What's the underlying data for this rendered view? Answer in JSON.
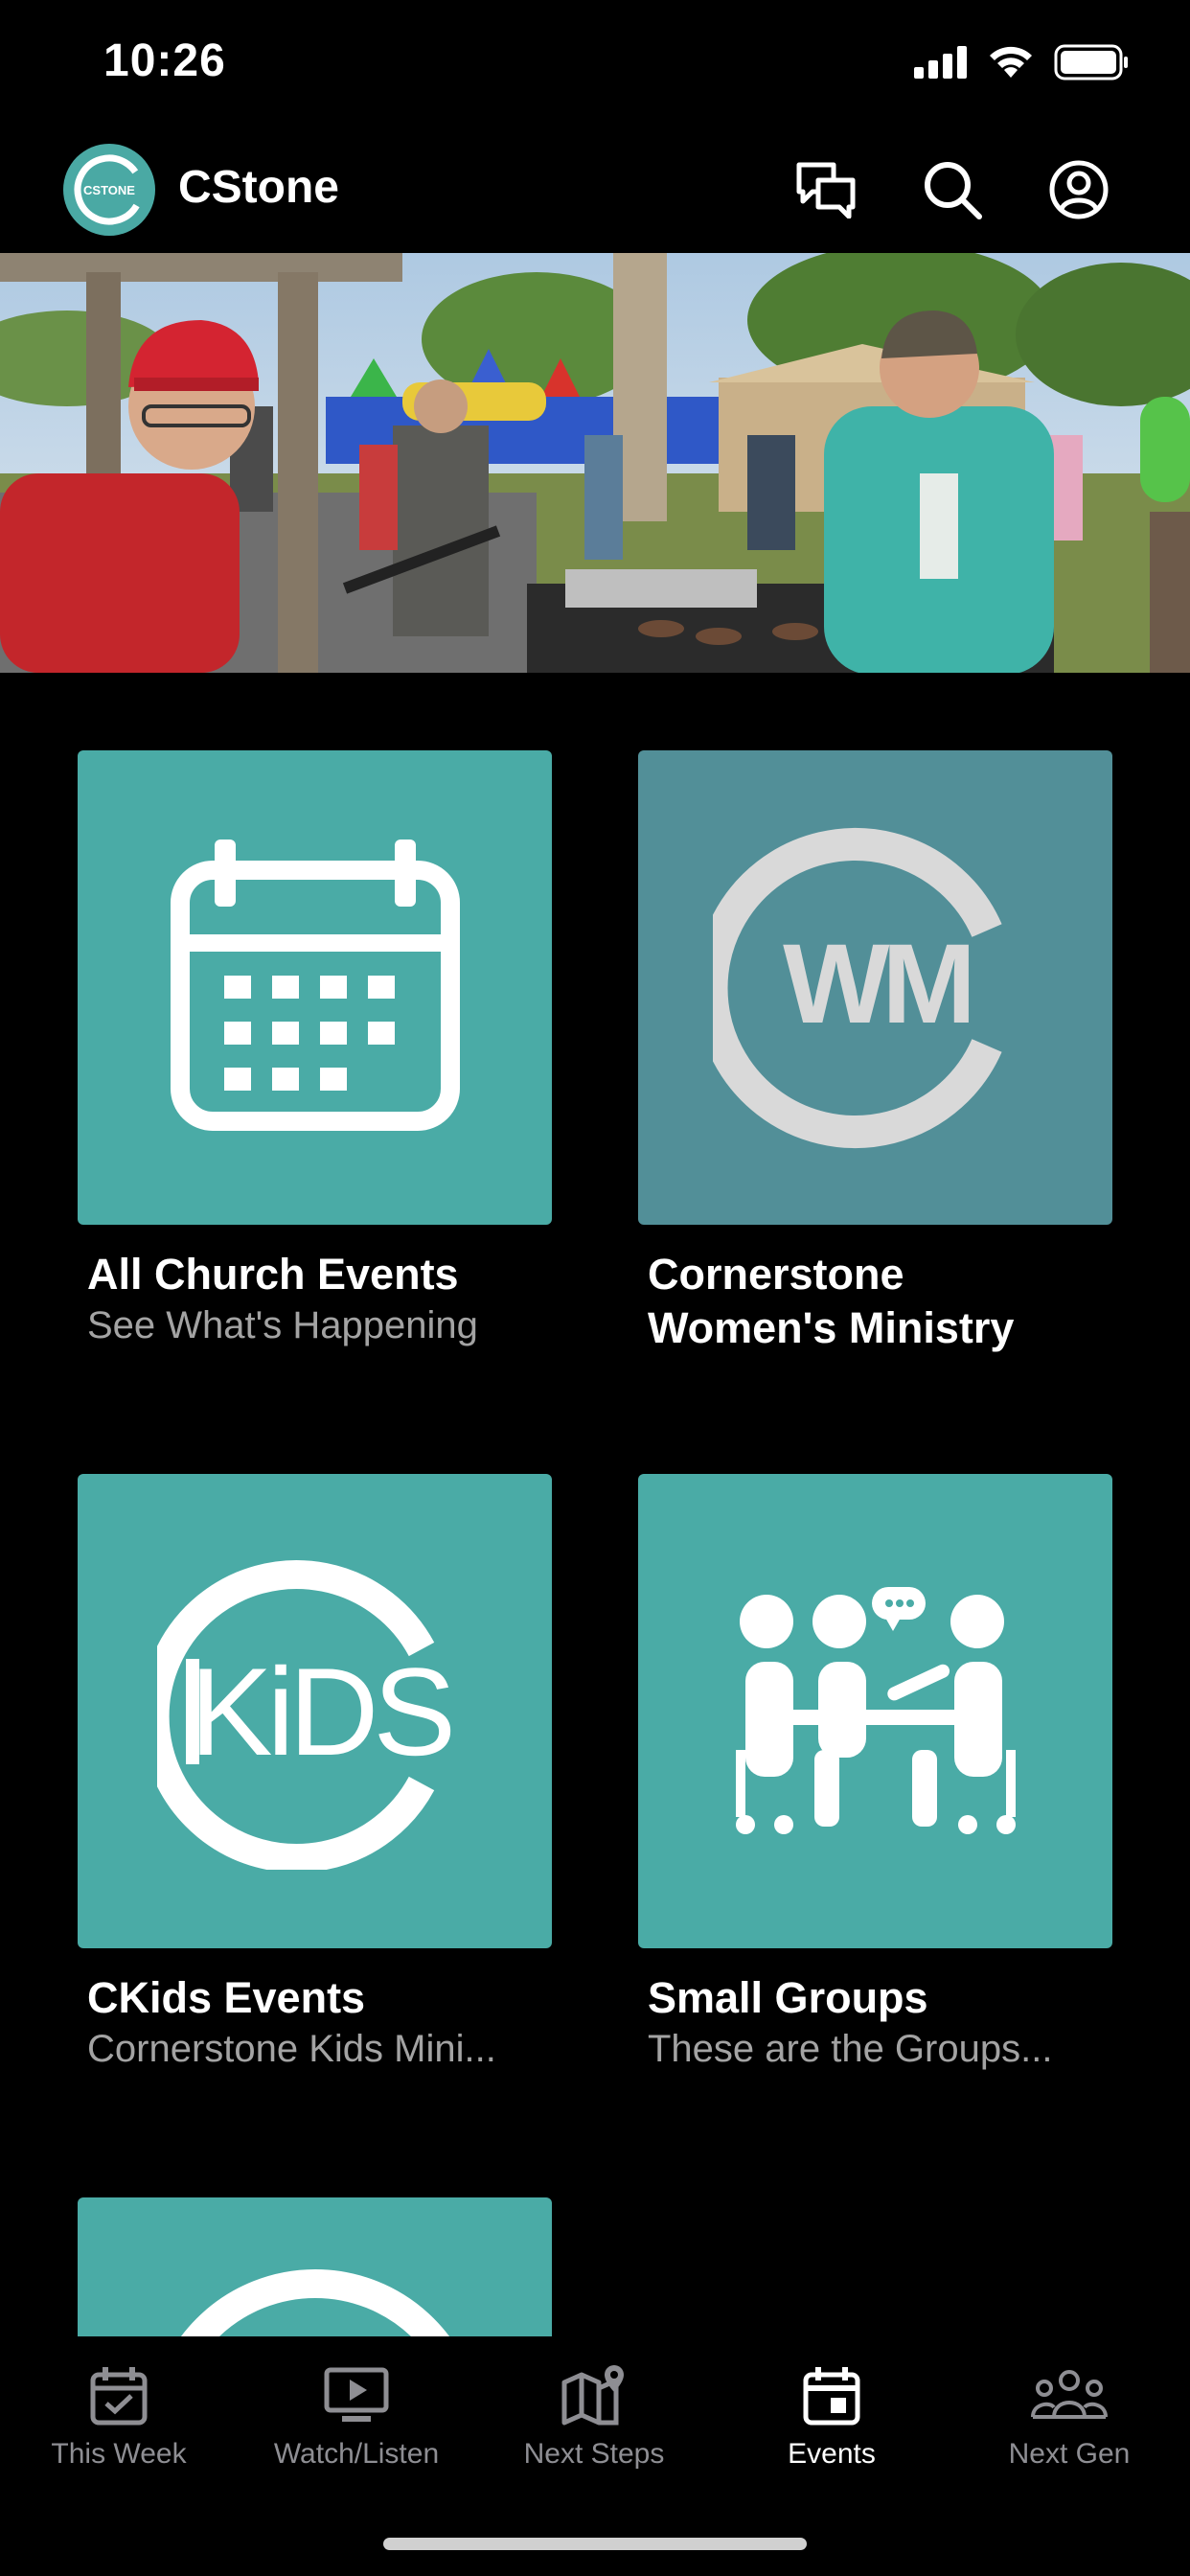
{
  "status_bar": {
    "time": "10:26"
  },
  "header": {
    "logo_text": "CSTONE",
    "title": "CStone"
  },
  "colors": {
    "teal": "#4aaba6",
    "slate": "#528f98",
    "background": "#000000"
  },
  "tiles": [
    {
      "title": "All Church Events",
      "subtitle": "See What's Happening",
      "icon": "calendar-icon"
    },
    {
      "title_line1": "Cornerstone",
      "title_line2": "Women's Ministry",
      "icon": "wmc-logo"
    },
    {
      "title": "CKids Events",
      "subtitle": "Cornerstone Kids Mini...",
      "icon": "ckids-logo"
    },
    {
      "title": "Small Groups",
      "subtitle": "These are the Groups...",
      "icon": "group-meeting-icon"
    }
  ],
  "tab_bar": {
    "items": [
      {
        "label": "This Week",
        "icon": "calendar-check-icon"
      },
      {
        "label": "Watch/Listen",
        "icon": "video-play-icon"
      },
      {
        "label": "Next Steps",
        "icon": "map-pin-icon"
      },
      {
        "label": "Events",
        "icon": "calendar-day-icon",
        "active": true
      },
      {
        "label": "Next Gen",
        "icon": "people-group-icon"
      }
    ]
  }
}
